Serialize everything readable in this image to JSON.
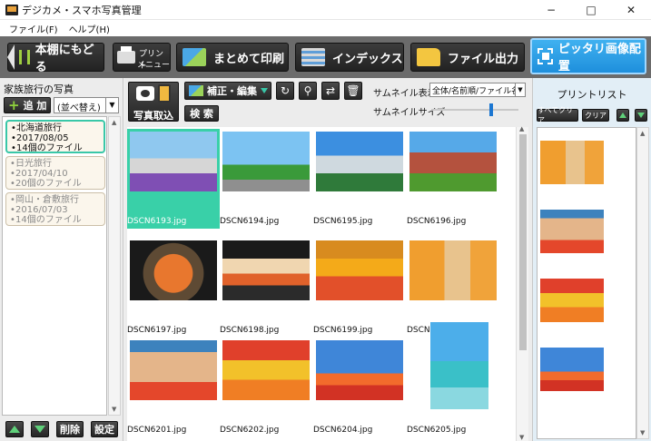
{
  "window": {
    "title": "デジカメ・スマホ写真管理",
    "min": "−",
    "max": "□",
    "close": "✕"
  },
  "menu": [
    "ファイル(F)",
    "ヘルプ(H)"
  ],
  "toolbar": {
    "back": "本棚にもどる",
    "print_menu_line1": "プリント",
    "print_menu_line2": "メニュー",
    "batch_print": "まとめて印刷",
    "index": "インデックス",
    "file_export": "ファイル出力",
    "fit_layout": "ピッタリ画像配置"
  },
  "left_panel": {
    "title": "家族旅行の写真",
    "add": "追 加",
    "sort": "(並べ替え)",
    "albums": [
      {
        "name": "北海道旅行",
        "date": "2017/08/05",
        "count": "14個のファイル",
        "selected": true
      },
      {
        "name": "日光旅行",
        "date": "2017/04/10",
        "count": "20個のファイル",
        "selected": false
      },
      {
        "name": "岡山・倉敷旅行",
        "date": "2016/07/03",
        "count": "14個のファイル",
        "selected": false
      }
    ],
    "delete": "削除",
    "settings": "設定"
  },
  "center": {
    "import": "写真取込",
    "edit": "補正・編集",
    "search": "検 索",
    "thumb_display_label": "サムネイル表示",
    "thumb_display_value": "全体/名前順/ファイル名",
    "thumb_size_label": "サムネイルサイズ",
    "thumb_size_value": 0.7
  },
  "photos": [
    {
      "name": "DSCN6193.jpg",
      "scene": "p-clock",
      "selected": true
    },
    {
      "name": "DSCN6194.jpg",
      "scene": "p-tower",
      "selected": false
    },
    {
      "name": "DSCN6195.jpg",
      "scene": "p-city",
      "selected": false
    },
    {
      "name": "DSCN6196.jpg",
      "scene": "p-redbrick",
      "selected": false
    },
    {
      "name": "DSCN6197.jpg",
      "scene": "p-ikura",
      "selected": false
    },
    {
      "name": "DSCN6198.jpg",
      "scene": "p-sushi",
      "selected": false
    },
    {
      "name": "DSCN6199.jpg",
      "scene": "p-tulip",
      "selected": false
    },
    {
      "name": "DSCN6200.jpg",
      "scene": "p-women",
      "selected": false
    },
    {
      "name": "DSCN6201.jpg",
      "scene": "p-women2",
      "selected": false
    },
    {
      "name": "DSCN6202.jpg",
      "scene": "p-flowers",
      "selected": false
    },
    {
      "name": "DSCN6204.jpg",
      "scene": "p-field",
      "selected": false
    },
    {
      "name": "DSCN6205.jpg",
      "scene": "p-lake",
      "selected": false,
      "portrait": true
    }
  ],
  "right_panel": {
    "title": "プリントリスト",
    "clear_all": "すべてクリア",
    "clear": "クリア",
    "items": [
      "p-women",
      "p-women2",
      "p-flowers",
      "p-field"
    ]
  },
  "colors": {
    "selection": "#39d0a8",
    "accent": "#1e8fdc"
  }
}
